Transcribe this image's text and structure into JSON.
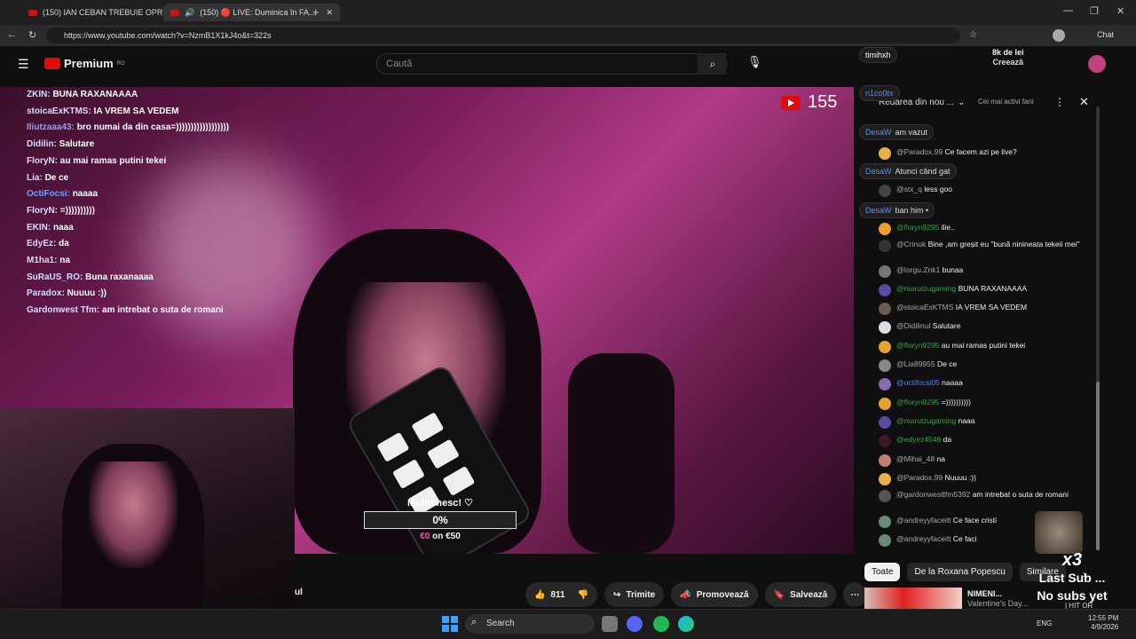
{
  "browser": {
    "tabs": [
      {
        "label": "(150) IAN CEBAN TREBUIE OPRIT"
      },
      {
        "label": "(150) 🔴 LIVE: Duminica în FA..."
      }
    ],
    "new_tab": "+",
    "url": "https://www.youtube.com/watch?v=NzmB1X1kJ4o&t=322s",
    "copilot_label": "Chat"
  },
  "youtube": {
    "logo": "Premium",
    "logo_region": "RO",
    "search_placeholder": "Caută",
    "top_overlay_user": "timihxh",
    "top_overlay_amount": "8k de lei",
    "top_overlay_action": "Creează"
  },
  "video": {
    "viewer_count": "155",
    "overlay_chat": [
      {
        "user": "ZKIN:",
        "msg": "BUNA RAXANAAAA"
      },
      {
        "user": "stoicaExKTMS:",
        "msg": "IA VREM SA VEDEM"
      },
      {
        "user": "Iliutzaaa43:",
        "msg": "bro numai da din casa=))))))))))))))))))"
      },
      {
        "user": "Didilin:",
        "msg": "Salutare"
      },
      {
        "user": "FloryN:",
        "msg": "au mai ramas putini tekei"
      },
      {
        "user": "Lia:",
        "msg": "De ce"
      },
      {
        "user": "OctiFocsi:",
        "msg": "naaaa"
      },
      {
        "user": "FloryN:",
        "msg": "=))))))))))"
      },
      {
        "user": "EKIN:",
        "msg": "naaa"
      },
      {
        "user": "EdyEz:",
        "msg": "da"
      },
      {
        "user": "M1ha1:",
        "msg": "na"
      },
      {
        "user": "SuRaUS_RO:",
        "msg": "Buna raxanaaaa"
      },
      {
        "user": "Paradox:",
        "msg": "Nuuuu :))"
      },
      {
        "user": "Gardonwest Tfm:",
        "msg": "am intrebat o suta de romani"
      }
    ],
    "goal": {
      "title": "Multumesc! ♡",
      "percent": "0%",
      "progress": 0,
      "current": "€0",
      "sep": "on",
      "target": "€50"
    },
    "partial_label": "ul"
  },
  "actions": {
    "likes": "811",
    "share": "Trimite",
    "promote": "Promovează",
    "save": "Salvează",
    "more": "⋯"
  },
  "chat": {
    "header": "Redarea din nou ...",
    "mode": "Cei mai activi fani",
    "messages": [
      {
        "author": "@Paradox.99",
        "text": "Ce facem azi pe live?",
        "color": "grey"
      },
      {
        "author": "@stx_q",
        "text": "less goo",
        "color": "grey"
      },
      {
        "author": "@floryn9295",
        "text": "ilie..",
        "color": "green"
      },
      {
        "author": "@Crinuk",
        "text": "Bine ,am greșit eu \"bună nininеata tekeii mei\"",
        "color": "grey"
      },
      {
        "author": "@Iorgu.Znk1",
        "text": "bunaa",
        "color": "grey"
      },
      {
        "author": "@marutzugaming",
        "text": "BUNA RAXANAAAA",
        "color": "green"
      },
      {
        "author": "@stoicaExKTMS",
        "text": "IA VREM SA VEDEM",
        "color": "grey"
      },
      {
        "author": "@Didilinul",
        "text": "Salutare",
        "color": "grey"
      },
      {
        "author": "@floryn9295",
        "text": "au mai ramas putini tekei",
        "color": "green"
      },
      {
        "author": "@Lia89955",
        "text": "De ce",
        "color": "grey"
      },
      {
        "author": "@octifocsi05",
        "text": "naaaa",
        "color": "blue"
      },
      {
        "author": "@floryn9295",
        "text": "=))))))))))",
        "color": "green"
      },
      {
        "author": "@marutzugaming",
        "text": "naaa",
        "color": "green"
      },
      {
        "author": "@edyez4546",
        "text": "da",
        "color": "green"
      },
      {
        "author": "@Mihai_48",
        "text": "na",
        "color": "grey"
      },
      {
        "author": "@Paradox.99",
        "text": "Nuuuu :))",
        "color": "grey"
      },
      {
        "author": "@gardonwesttfm5392",
        "text": "am intrebat o suta de romani",
        "color": "grey"
      },
      {
        "author": "@andreyyfaceitt",
        "text": "Ce face cristi",
        "color": "grey"
      },
      {
        "author": "@andreyyfaceitt",
        "text": "Ce faci",
        "color": "grey"
      }
    ],
    "top_overlays": [
      {
        "user": "n1co0tx"
      },
      {
        "user": "DesaW",
        "msg": "am vazut"
      },
      {
        "user": "DesaW",
        "msg": "Atunci când gat"
      },
      {
        "user": "DesaW",
        "msg": "ban him •"
      }
    ]
  },
  "chips": [
    "Toate",
    "De la Roxana Popescu",
    "Similare"
  ],
  "recommendation": {
    "title": "NIMENI...",
    "subtitle": "Valentine's Day...",
    "extra": "| HIT OR"
  },
  "sub_widget": {
    "multiplier": "x3",
    "line1": "Last Sub ...",
    "line2": "No subs yet"
  },
  "taskbar": {
    "search": "Search",
    "lang": "ENG",
    "time": "12:55 PM",
    "date": "4/9/2026"
  },
  "colors": {
    "accent": "#e10b0b",
    "pink": "#e04aa0",
    "green": "#2ba640"
  }
}
